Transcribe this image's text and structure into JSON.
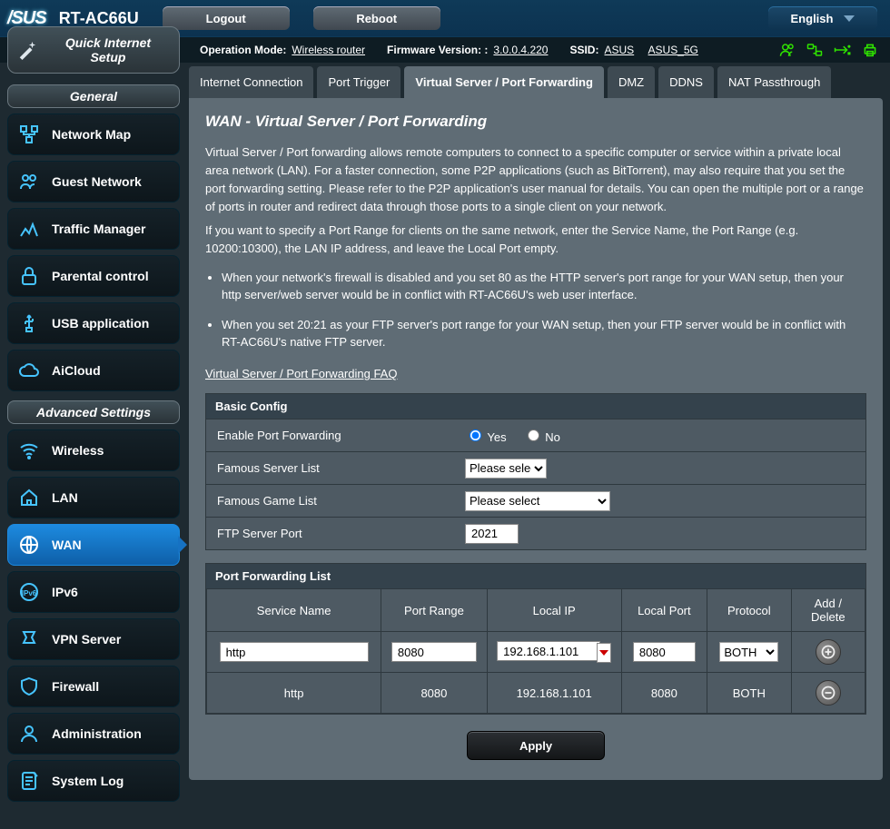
{
  "top": {
    "brand": "/SUS",
    "model": "RT-AC66U",
    "logout": "Logout",
    "reboot": "Reboot",
    "language": "English"
  },
  "status": {
    "op_mode_label": "Operation Mode:",
    "op_mode": "Wireless router",
    "fw_label": "Firmware Version: :",
    "fw": "3.0.0.4.220",
    "ssid_label": "SSID:",
    "ssid1": "ASUS",
    "ssid2": "ASUS_5G"
  },
  "quick": "Quick Internet Setup",
  "section_general": "General",
  "section_advanced": "Advanced Settings",
  "nav_general": [
    "Network Map",
    "Guest Network",
    "Traffic Manager",
    "Parental control",
    "USB application",
    "AiCloud"
  ],
  "nav_advanced": [
    "Wireless",
    "LAN",
    "WAN",
    "IPv6",
    "VPN Server",
    "Firewall",
    "Administration",
    "System Log"
  ],
  "tabs": [
    "Internet Connection",
    "Port Trigger",
    "Virtual Server / Port Forwarding",
    "DMZ",
    "DDNS",
    "NAT Passthrough"
  ],
  "page": {
    "title": "WAN - Virtual Server / Port Forwarding",
    "para1": "Virtual Server / Port forwarding allows remote computers to connect to a specific computer or service within a private local area network (LAN). For a faster connection, some P2P applications (such as BitTorrent), may also require that you set the port forwarding setting. Please refer to the P2P application's user manual for details. You can open the multiple port or a range of ports in router and redirect data through those ports to a single client on your network.",
    "para2": "If you want to specify a Port Range for clients on the same network, enter the Service Name, the Port Range (e.g. 10200:10300), the LAN IP address, and leave the Local Port empty.",
    "bullet1": "When your network's firewall is disabled and you set 80 as the HTTP server's port range for your WAN setup, then your http server/web server would be in conflict with RT-AC66U's web user interface.",
    "bullet2": "When you set 20:21 as your FTP server's port range for your WAN setup, then your FTP server would be in conflict with RT-AC66U's native FTP server.",
    "faq": "Virtual Server / Port Forwarding FAQ"
  },
  "basic": {
    "title": "Basic Config",
    "enable_label": "Enable Port Forwarding",
    "yes": "Yes",
    "no": "No",
    "server_list_label": "Famous Server List",
    "game_list_label": "Famous Game List",
    "select_placeholder": "Please select",
    "ftp_label": "FTP Server Port",
    "ftp_value": "2021"
  },
  "pfl": {
    "title": "Port Forwarding List",
    "cols": [
      "Service Name",
      "Port Range",
      "Local IP",
      "Local Port",
      "Protocol",
      "Add / Delete"
    ],
    "input": {
      "service": "http",
      "range": "8080",
      "ip": "192.168.1.101",
      "local": "8080",
      "proto": "BOTH"
    },
    "rows": [
      {
        "service": "http",
        "range": "8080",
        "ip": "192.168.1.101",
        "local": "8080",
        "proto": "BOTH"
      }
    ]
  },
  "apply": "Apply"
}
